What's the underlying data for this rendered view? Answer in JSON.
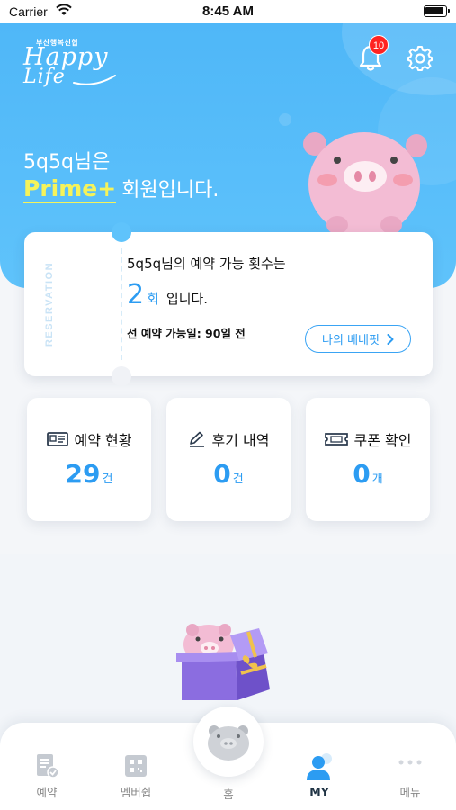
{
  "status_bar": {
    "carrier": "Carrier",
    "time": "8:45 AM"
  },
  "header": {
    "logo_sub": "부산행복신협",
    "logo_line1": "Happy",
    "logo_line2": "Life",
    "notification_count": "10"
  },
  "greeting": {
    "line1": "5q5q님은",
    "tier": "Prime+",
    "line2_suffix": "회원입니다."
  },
  "reservation": {
    "side_label": "RESERVATION",
    "line1": "5q5q님의 예약 가능 횟수는",
    "count": "2",
    "count_unit": "회",
    "count_suffix": "입니다.",
    "advance": "선 예약 가능일: 90일 전",
    "benefit_button": "나의 베네핏"
  },
  "stats": [
    {
      "label": "예약 현황",
      "value": "29",
      "unit": "건",
      "icon": "reservation-icon"
    },
    {
      "label": "후기 내역",
      "value": "0",
      "unit": "건",
      "icon": "pencil-icon"
    },
    {
      "label": "쿠폰 확인",
      "value": "0",
      "unit": "개",
      "icon": "ticket-icon"
    }
  ],
  "tabbar": {
    "items": [
      {
        "label": "예약",
        "icon": "document-check-icon"
      },
      {
        "label": "멤버쉽",
        "icon": "qr-card-icon"
      },
      {
        "label": "홈",
        "icon": "pig-home-icon"
      },
      {
        "label": "MY",
        "icon": "person-icon",
        "active": true
      },
      {
        "label": "메뉴",
        "icon": "dots-icon"
      }
    ]
  },
  "colors": {
    "primary": "#2c9cf2",
    "hero": "#5fc3fb",
    "prime": "#f5f35a"
  }
}
